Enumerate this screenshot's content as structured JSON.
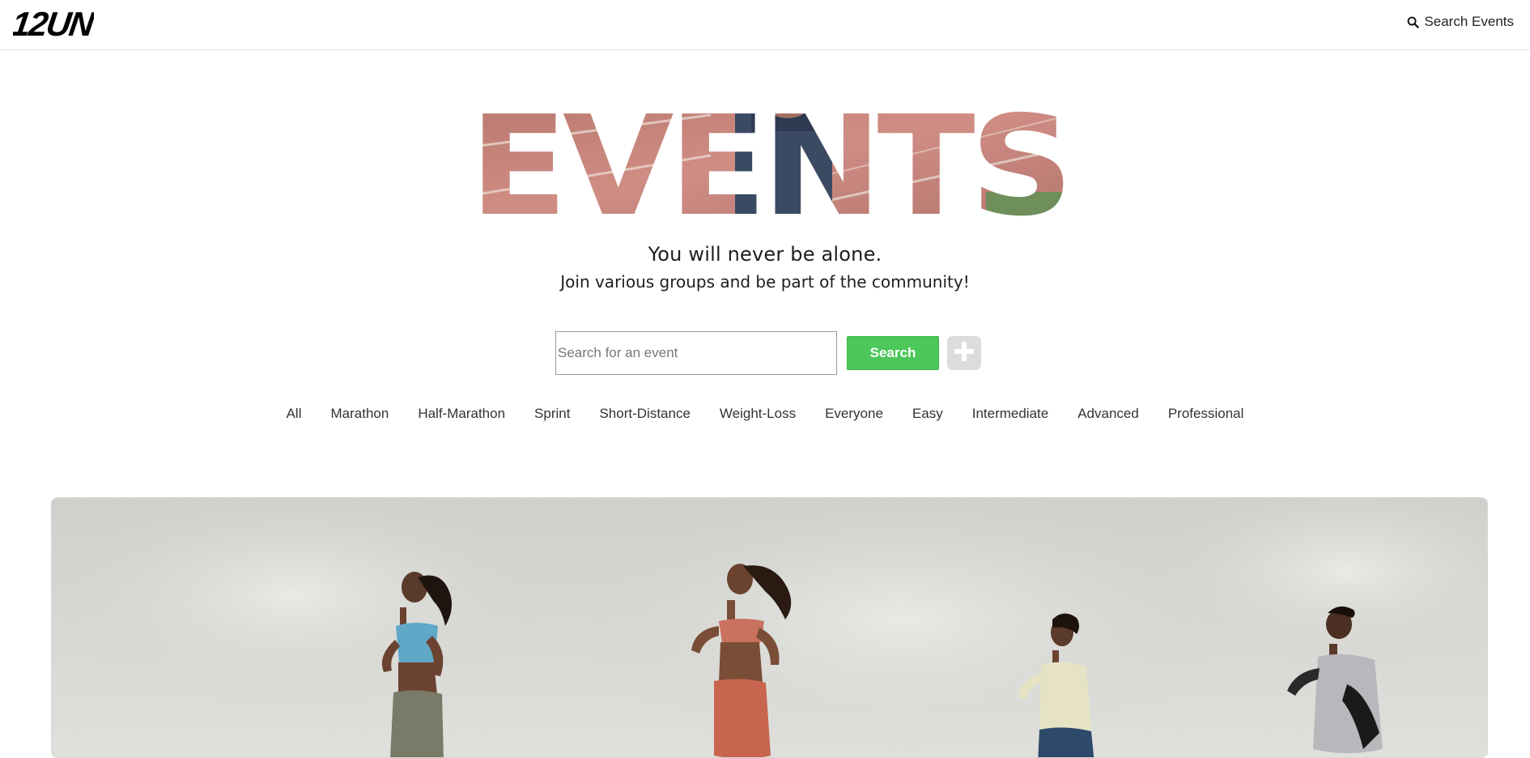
{
  "header": {
    "logo_text": "12UN",
    "search_events_label": "Search Events",
    "search_icon": "search-icon"
  },
  "hero": {
    "title": "EVENTS",
    "tagline_primary": "You will never be alone.",
    "tagline_secondary": "Join various groups and be part of the community!"
  },
  "search": {
    "placeholder": "Search for an event",
    "value": "",
    "button_label": "Search",
    "add_icon": "plus-icon"
  },
  "filters": [
    "All",
    "Marathon",
    "Half-Marathon",
    "Sprint",
    "Short-Distance",
    "Weight-Loss",
    "Everyone",
    "Easy",
    "Intermediate",
    "Advanced",
    "Professional"
  ],
  "colors": {
    "accent": "#4cc75a",
    "track": "#c8857c",
    "add_button_bg": "#dcdcdc"
  }
}
